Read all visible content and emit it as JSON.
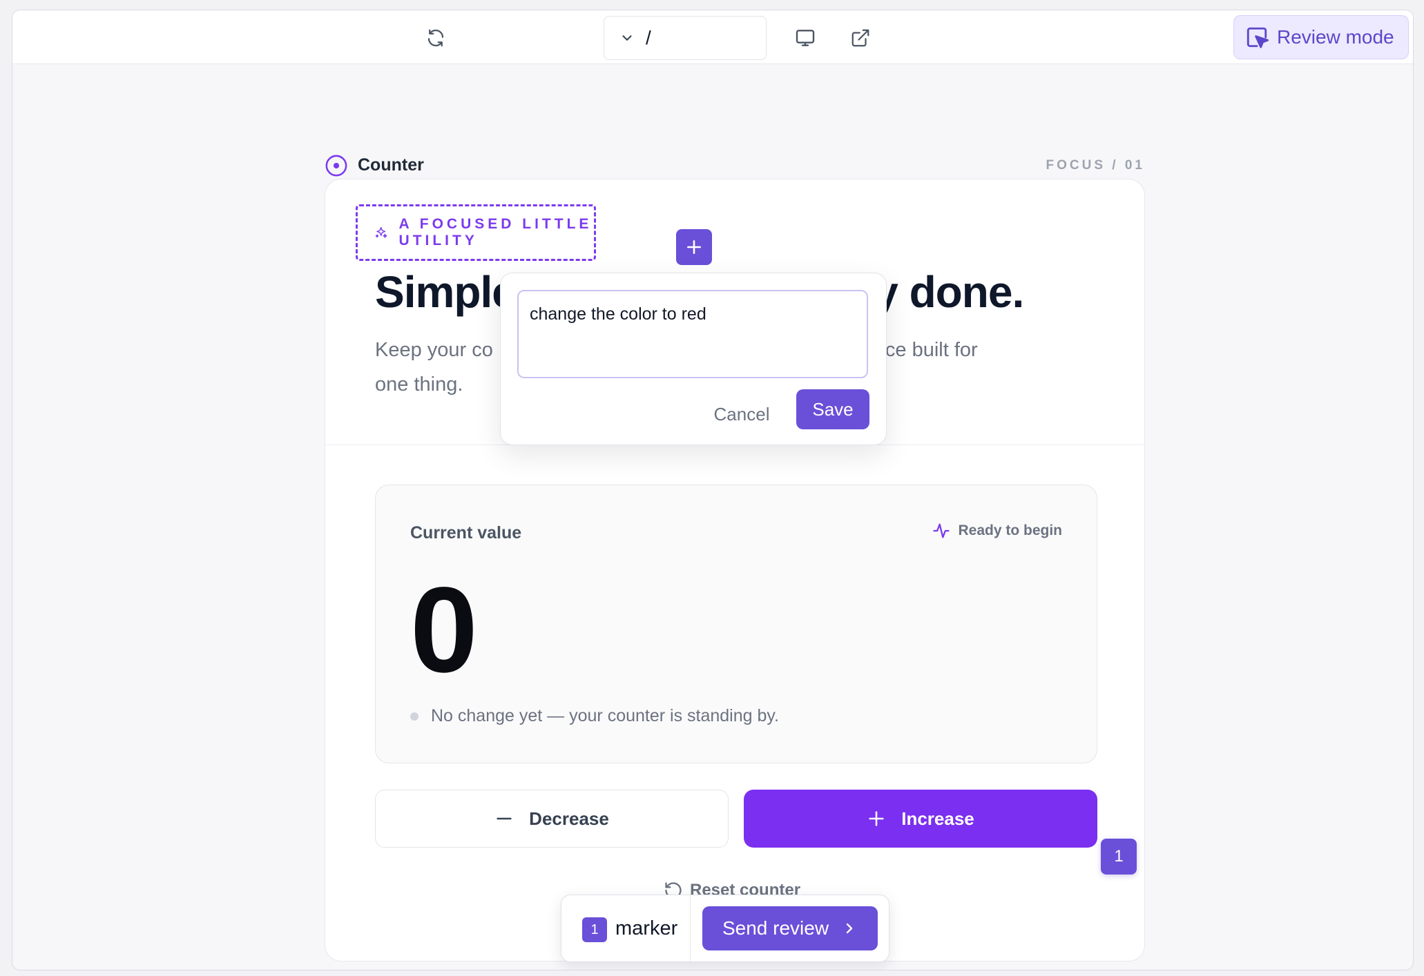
{
  "toolbar": {
    "path": "/",
    "review_mode_label": "Review mode"
  },
  "section": {
    "title": "Counter",
    "focus_label": "FOCUS / 01"
  },
  "hero": {
    "tag_label": "A FOCUSED LITTLE UTILITY",
    "headline_start": "Simple",
    "headline_end": "lly done.",
    "subtitle_start": "Keep your co",
    "subtitle_end": "ce built for",
    "subtitle_line2": "one thing."
  },
  "counter": {
    "label": "Current value",
    "status": "Ready to begin",
    "value": "0",
    "note": "No change yet — your counter is standing by.",
    "decrease_label": "Decrease",
    "increase_label": "Increase",
    "reset_label": "Reset counter"
  },
  "comment_popup": {
    "text": "change the color to red",
    "cancel_label": "Cancel",
    "save_label": "Save"
  },
  "markers": {
    "badge_number": "1",
    "count": "1",
    "count_label": "marker",
    "send_label": "Send review"
  },
  "colors": {
    "accent": "#7b2ff0",
    "review_accent": "#6a4fd8"
  }
}
